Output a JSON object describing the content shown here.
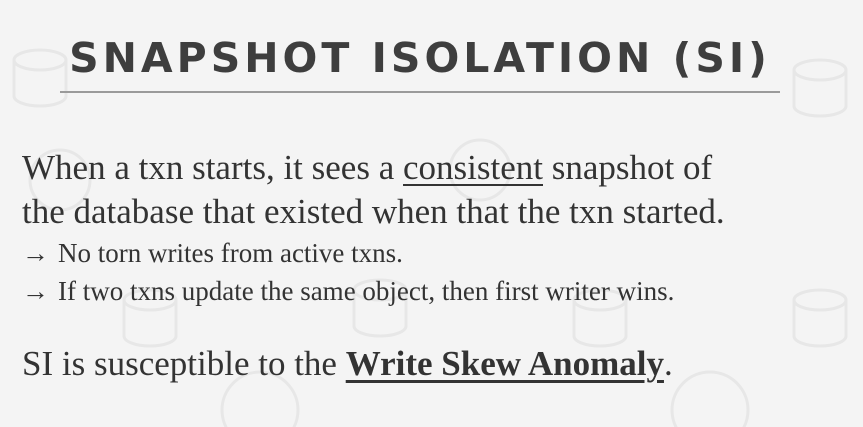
{
  "slide": {
    "title": "SNAPSHOT ISOLATION (SI)",
    "paragraph1": {
      "before": "When a txn starts, it sees a ",
      "underlined": "consistent",
      "after_line1": " snapshot of",
      "line2": "the database that existed when that the txn started."
    },
    "bullets": [
      {
        "arrow": "→",
        "text": "No torn writes from active txns."
      },
      {
        "arrow": "→",
        "text": "If two txns update the same object, then first writer wins."
      }
    ],
    "paragraph2": {
      "before": "SI is susceptible to the ",
      "emphasis": "Write Skew Anomaly",
      "after": "."
    }
  },
  "colors": {
    "background": "#f4f4f4",
    "title": "#3e3e3e",
    "text": "#333333",
    "rule": "#9a9a9a",
    "pattern": "#e6e6e6"
  }
}
